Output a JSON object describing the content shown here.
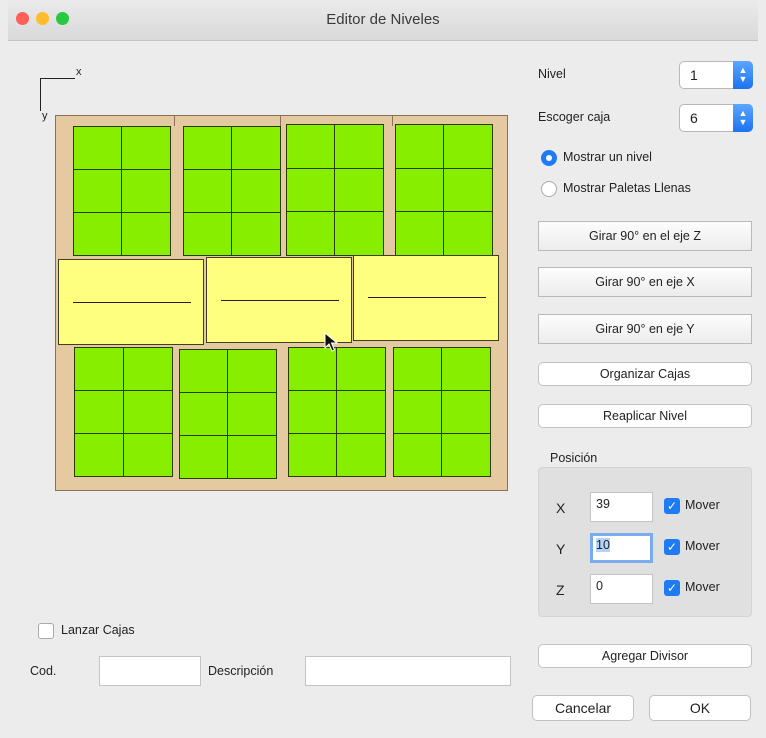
{
  "window": {
    "title": "Editor de Niveles"
  },
  "axes": {
    "x_label": "x",
    "y_label": "y"
  },
  "controls": {
    "nivel_label": "Nivel",
    "nivel_value": "1",
    "caja_label": "Escoger caja",
    "caja_value": "6",
    "radio_one": "Mostrar un nivel",
    "radio_all": "Mostrar Paletas Llenas",
    "btn_rot_z": "Girar 90° en el eje Z",
    "btn_rot_x": "Girar 90° en eje X",
    "btn_rot_y": "Girar 90° en eje Y",
    "btn_organize": "Organizar Cajas",
    "btn_replicate": "Reaplicar Nivel",
    "btn_divider": "Agregar Divisor",
    "btn_cancel": "Cancelar",
    "btn_ok": "OK"
  },
  "position": {
    "title": "Posición",
    "x_label": "X",
    "x_value": "39",
    "y_label": "Y",
    "y_value": "10",
    "z_label": "Z",
    "z_value": "0",
    "move_label": "Mover"
  },
  "footer": {
    "launch_label": "Lanzar Cajas",
    "cod_label": "Cod.",
    "cod_value": "",
    "desc_label": "Descripción",
    "desc_value": ""
  },
  "colors": {
    "pallet": "#e5c9a1",
    "box_green": "#88ee00",
    "box_yellow": "#ffff7f",
    "accent": "#1f7bf3"
  },
  "icons": {
    "close": "close-dot-icon",
    "minimize": "minimize-dot-icon",
    "zoom": "zoom-dot-icon",
    "cursor": "arrow-cursor-icon",
    "checkmark": "checkmark-icon"
  }
}
